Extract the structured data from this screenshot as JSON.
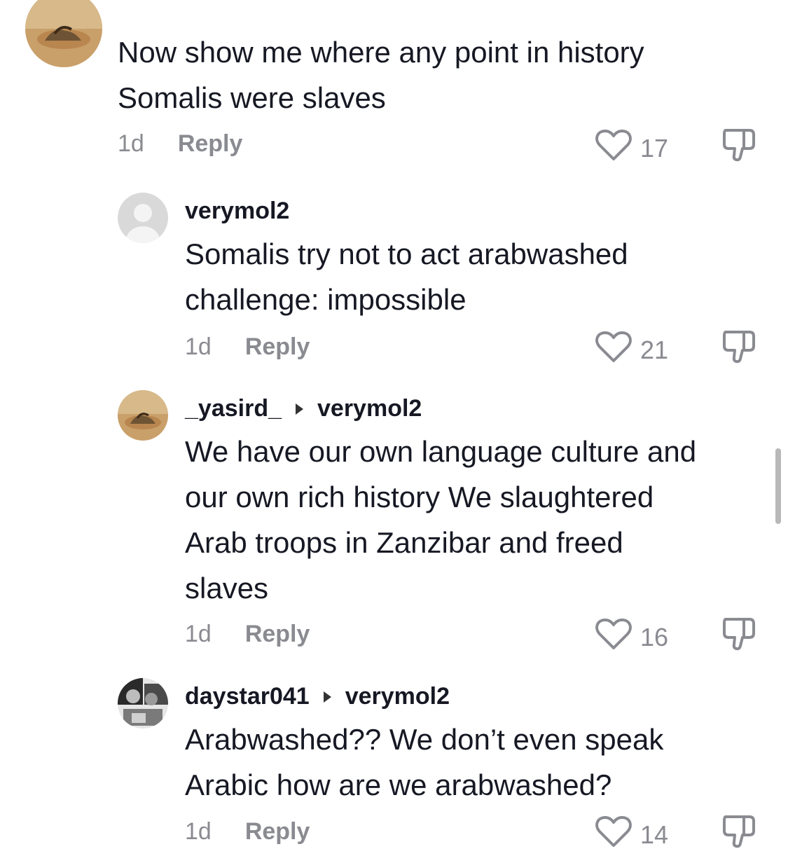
{
  "comments": [
    {
      "username": "",
      "reply_to": "",
      "body": "Now show me where any point in history\nSomalis were slaves",
      "time": "1d",
      "reply_label": "Reply",
      "likes": "17"
    },
    {
      "username": "verymol2",
      "reply_to": "",
      "body": "Somalis try not to act arabwashed\nchallenge: impossible",
      "time": "1d",
      "reply_label": "Reply",
      "likes": "21"
    },
    {
      "username": "_yasird_",
      "reply_to": "verymol2",
      "body": "We have our own language culture and\nour own rich history We slaughtered\nArab troops in Zanzibar and freed\nslaves",
      "time": "1d",
      "reply_label": "Reply",
      "likes": "16"
    },
    {
      "username": "daystar041",
      "reply_to": "verymol2",
      "body": "Arabwashed?? We don’t even speak\nArabic how are we arabwashed?",
      "time": "1d",
      "reply_label": "Reply",
      "likes": "14"
    }
  ],
  "icons": {
    "like": "heart-outline-icon",
    "dislike": "thumbs-down-icon",
    "reply_arrow": "triangle-right-icon"
  },
  "colors": {
    "text": "#161823",
    "muted": "#8a8b91"
  }
}
